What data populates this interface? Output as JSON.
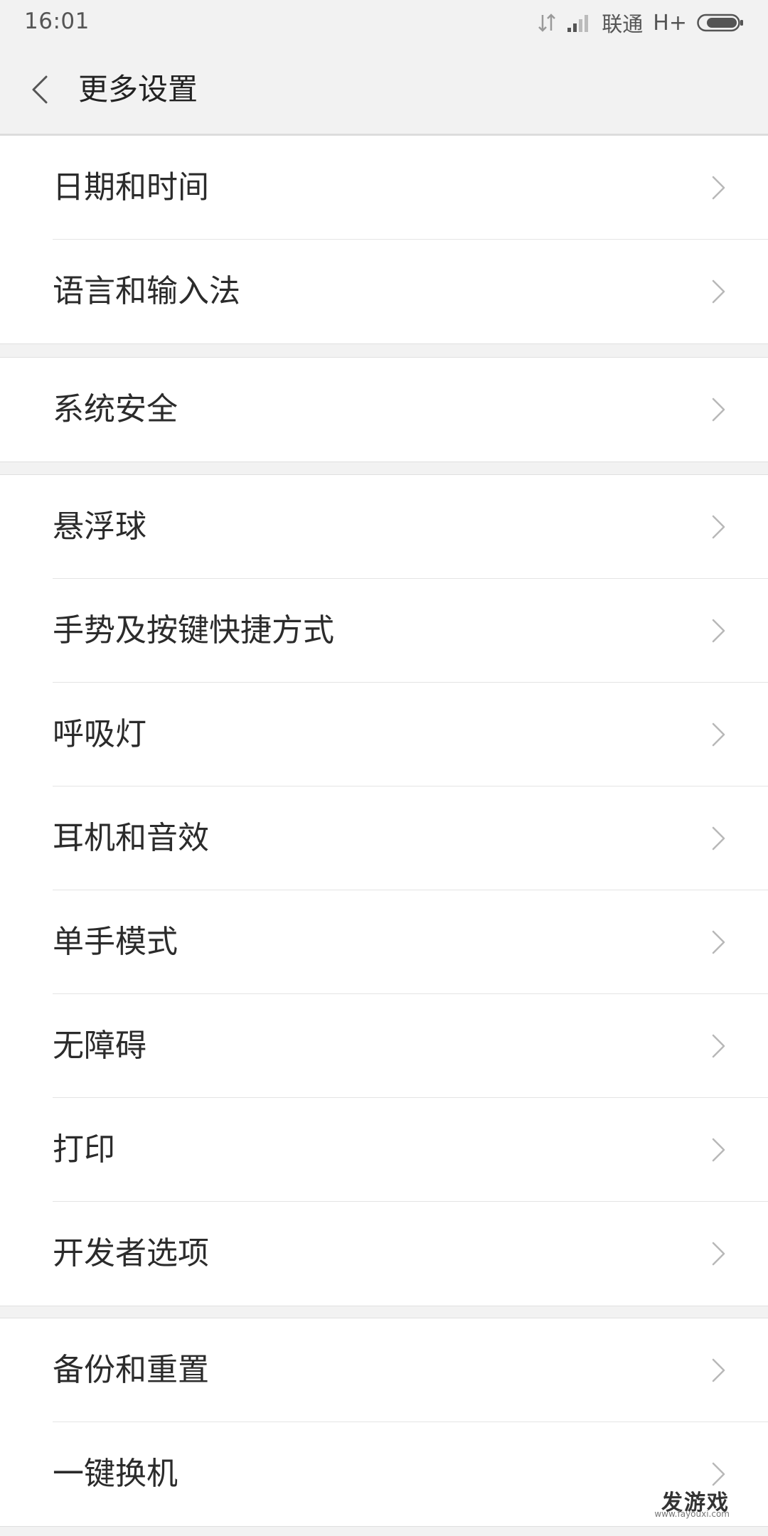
{
  "status_bar": {
    "time": "16:01",
    "carrier": "联通",
    "network": "H+"
  },
  "header": {
    "title": "更多设置"
  },
  "groups": [
    [
      "日期和时间",
      "语言和输入法"
    ],
    [
      "系统安全"
    ],
    [
      "悬浮球",
      "手势及按键快捷方式",
      "呼吸灯",
      "耳机和音效",
      "单手模式",
      "无障碍",
      "打印",
      "开发者选项"
    ],
    [
      "备份和重置",
      "一键换机"
    ]
  ],
  "watermark": {
    "main": "发游戏",
    "sub": "www.fayouxi.com"
  },
  "colors": {
    "background": "#f2f2f2",
    "row_background": "#ffffff",
    "divider": "#e4e4e4",
    "text": "#2b2b2b",
    "chevron": "#b8b8b8"
  }
}
